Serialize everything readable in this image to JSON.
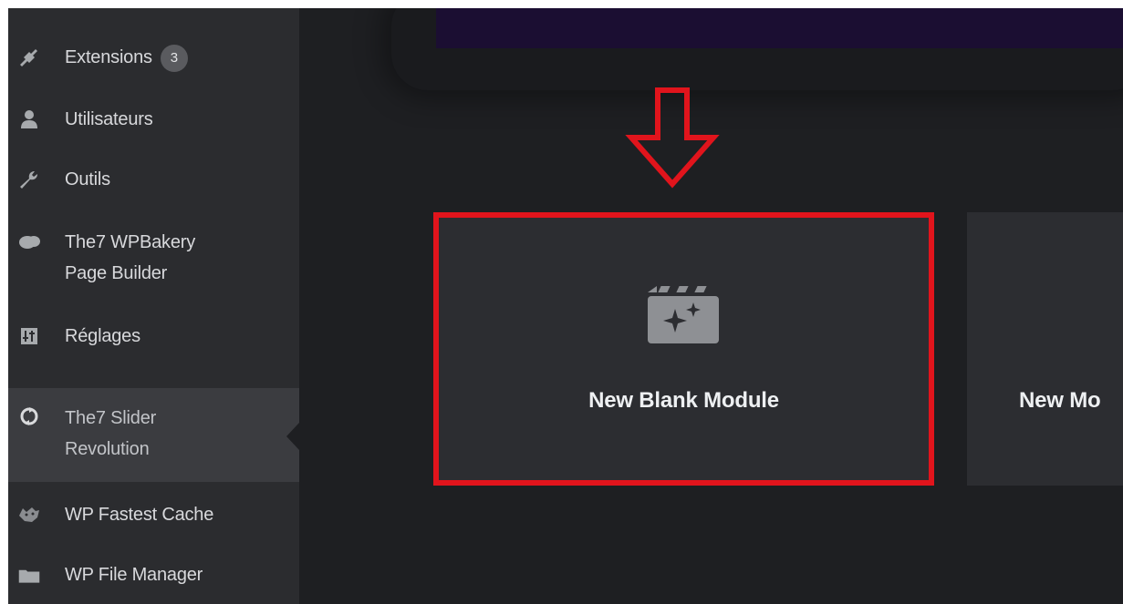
{
  "sidebar": {
    "items": [
      {
        "label": "Extensions",
        "badge": "3",
        "icon": "plugin-icon"
      },
      {
        "label": "Utilisateurs",
        "icon": "user-icon"
      },
      {
        "label": "Outils",
        "icon": "wrench-icon"
      },
      {
        "label": "The7 WPBakery",
        "label2": "Page Builder",
        "icon": "page-builder-cloud-icon"
      },
      {
        "label": "Réglages",
        "icon": "settings-sliders-icon"
      },
      {
        "label": "The7 Slider",
        "label2": "Revolution",
        "icon": "refresh-icon",
        "active": true
      },
      {
        "label": "WP Fastest Cache",
        "icon": "cheetah-icon"
      },
      {
        "label": "WP File Manager",
        "icon": "folder-icon"
      }
    ]
  },
  "modules": {
    "blank": {
      "title": "New Blank Module",
      "icon": "clapperboard-sparkle-icon",
      "highlight_color": "#e1141c"
    },
    "second": {
      "title": "New Mo"
    }
  },
  "annotation": {
    "arrow_color": "#e1141c",
    "icon": "down-arrow-icon"
  },
  "colors": {
    "sidebar_bg": "#2b2c2f",
    "content_bg": "#1e1f22",
    "card_bg": "#2c2d31",
    "topbar_bg": "#1b0e32"
  }
}
